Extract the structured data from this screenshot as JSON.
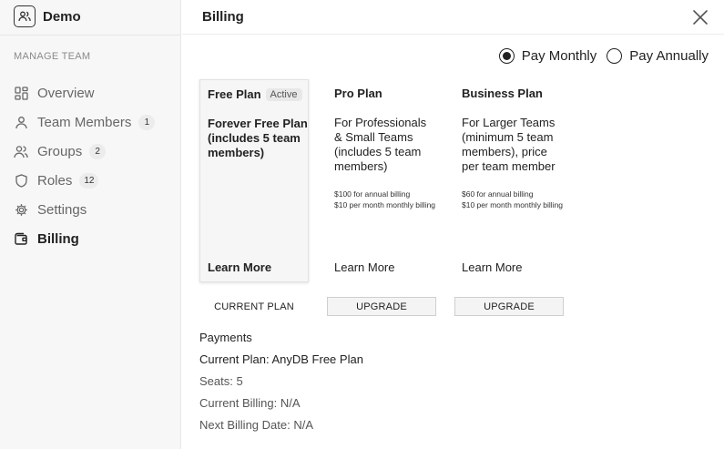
{
  "app": {
    "name": "Demo"
  },
  "sidebar": {
    "section_label": "MANAGE TEAM",
    "items": [
      {
        "label": "Overview",
        "icon": "grid-icon",
        "badge": null,
        "active": false
      },
      {
        "label": "Team Members",
        "icon": "user-icon",
        "badge": "1",
        "active": false
      },
      {
        "label": "Groups",
        "icon": "users-icon",
        "badge": "2",
        "active": false
      },
      {
        "label": "Roles",
        "icon": "shield-icon",
        "badge": "12",
        "active": false
      },
      {
        "label": "Settings",
        "icon": "gear-icon",
        "badge": null,
        "active": false
      },
      {
        "label": "Billing",
        "icon": "wallet-icon",
        "badge": null,
        "active": true
      }
    ]
  },
  "header": {
    "title": "Billing"
  },
  "billing_toggle": {
    "options": [
      {
        "label": "Pay Monthly",
        "selected": true
      },
      {
        "label": "Pay Annually",
        "selected": false
      }
    ]
  },
  "plans": [
    {
      "name": "Free Plan",
      "badge": "Active",
      "description": "Forever Free Plan (includes 5 team members)",
      "prices": [],
      "learn_more": "Learn More",
      "action": "CURRENT PLAN"
    },
    {
      "name": "Pro Plan",
      "badge": null,
      "description": "For Professionals & Small Teams (includes 5 team members)",
      "prices": [
        "$100 for annual billing",
        "$10 per month monthly billing"
      ],
      "learn_more": "Learn More",
      "action": "UPGRADE"
    },
    {
      "name": "Business Plan",
      "badge": null,
      "description": "For Larger Teams (minimum 5 team members), price per team member",
      "prices": [
        "$60 for annual billing",
        "$10 per month monthly billing"
      ],
      "learn_more": "Learn More",
      "action": "UPGRADE"
    }
  ],
  "payments": {
    "title": "Payments",
    "current_plan": "Current Plan: AnyDB Free Plan",
    "seats": "Seats: 5",
    "current_billing": "Current Billing: N/A",
    "next_billing_date": "Next Billing Date: N/A"
  }
}
